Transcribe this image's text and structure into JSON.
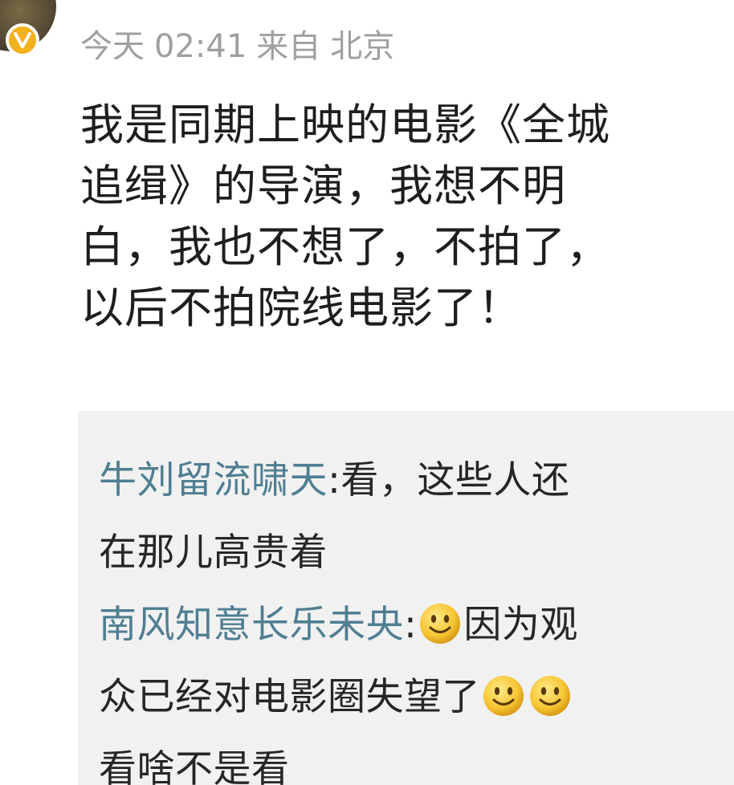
{
  "post": {
    "meta": {
      "date": "今天",
      "time": "02:41",
      "source_prefix": "来自",
      "source_location": "北京"
    },
    "lines": [
      "我是同期上映的电影《全城",
      "追缉》的导演，我想不明",
      "白，我也不想了，不拍了，",
      "以后不拍院线电影了！"
    ]
  },
  "replies": [
    {
      "author": "牛刘留流啸天",
      "separator": ":",
      "line1": "看，这些人还",
      "line2": "在那儿高贵着"
    },
    {
      "author": "南风知意长乐未央",
      "separator": ":",
      "line1": "因为观",
      "line2": "众已经对电影圈失望了",
      "line3": "看啥不是看"
    }
  ],
  "icons": {
    "avatar": "avatar",
    "badge": "vip-badge-icon",
    "emoji": "smile-emoji-icon"
  },
  "colors": {
    "author": "#4f7e92",
    "meta": "#a0a0a0",
    "badge": "#f3b21d",
    "reply_bg": "#f1f1f1"
  }
}
